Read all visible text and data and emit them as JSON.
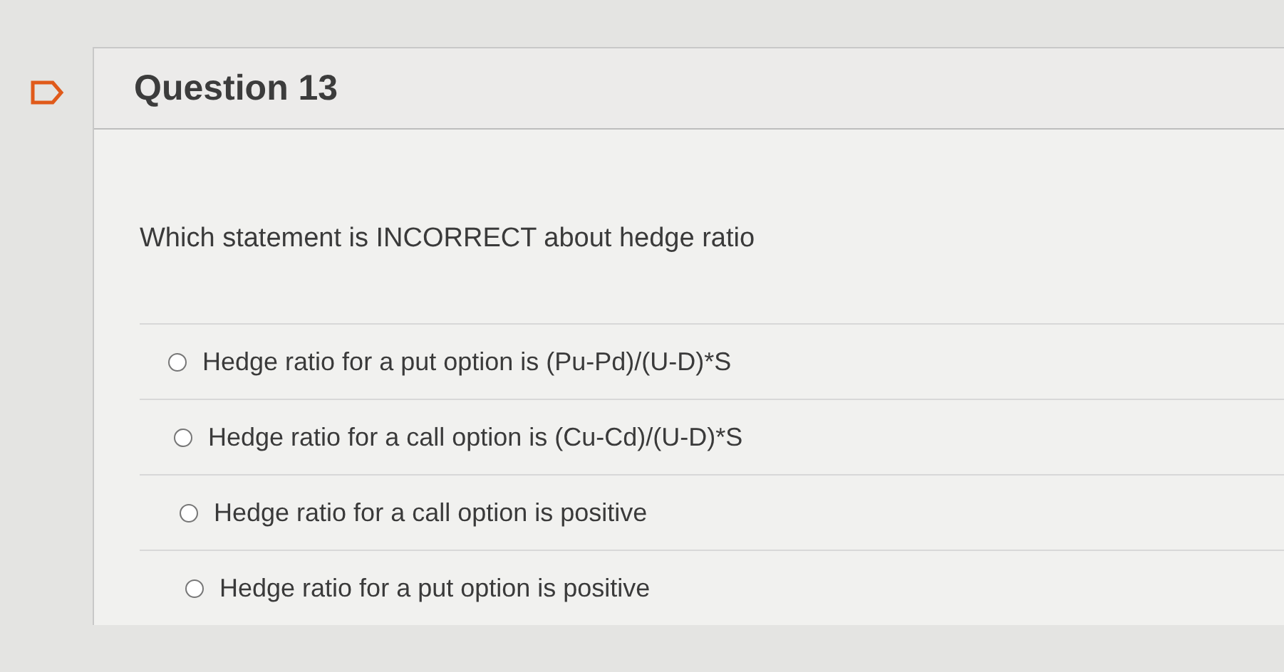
{
  "question": {
    "title": "Question 13",
    "flagged": false,
    "prompt": "Which statement is INCORRECT about hedge ratio",
    "options": [
      {
        "label": "Hedge ratio for a put option is (Pu-Pd)/(U-D)*S",
        "selected": false
      },
      {
        "label": "Hedge ratio for a call option is (Cu-Cd)/(U-D)*S",
        "selected": false
      },
      {
        "label": "Hedge ratio for a call option is positive",
        "selected": false
      },
      {
        "label": "Hedge ratio for a put option is positive",
        "selected": false
      }
    ]
  }
}
